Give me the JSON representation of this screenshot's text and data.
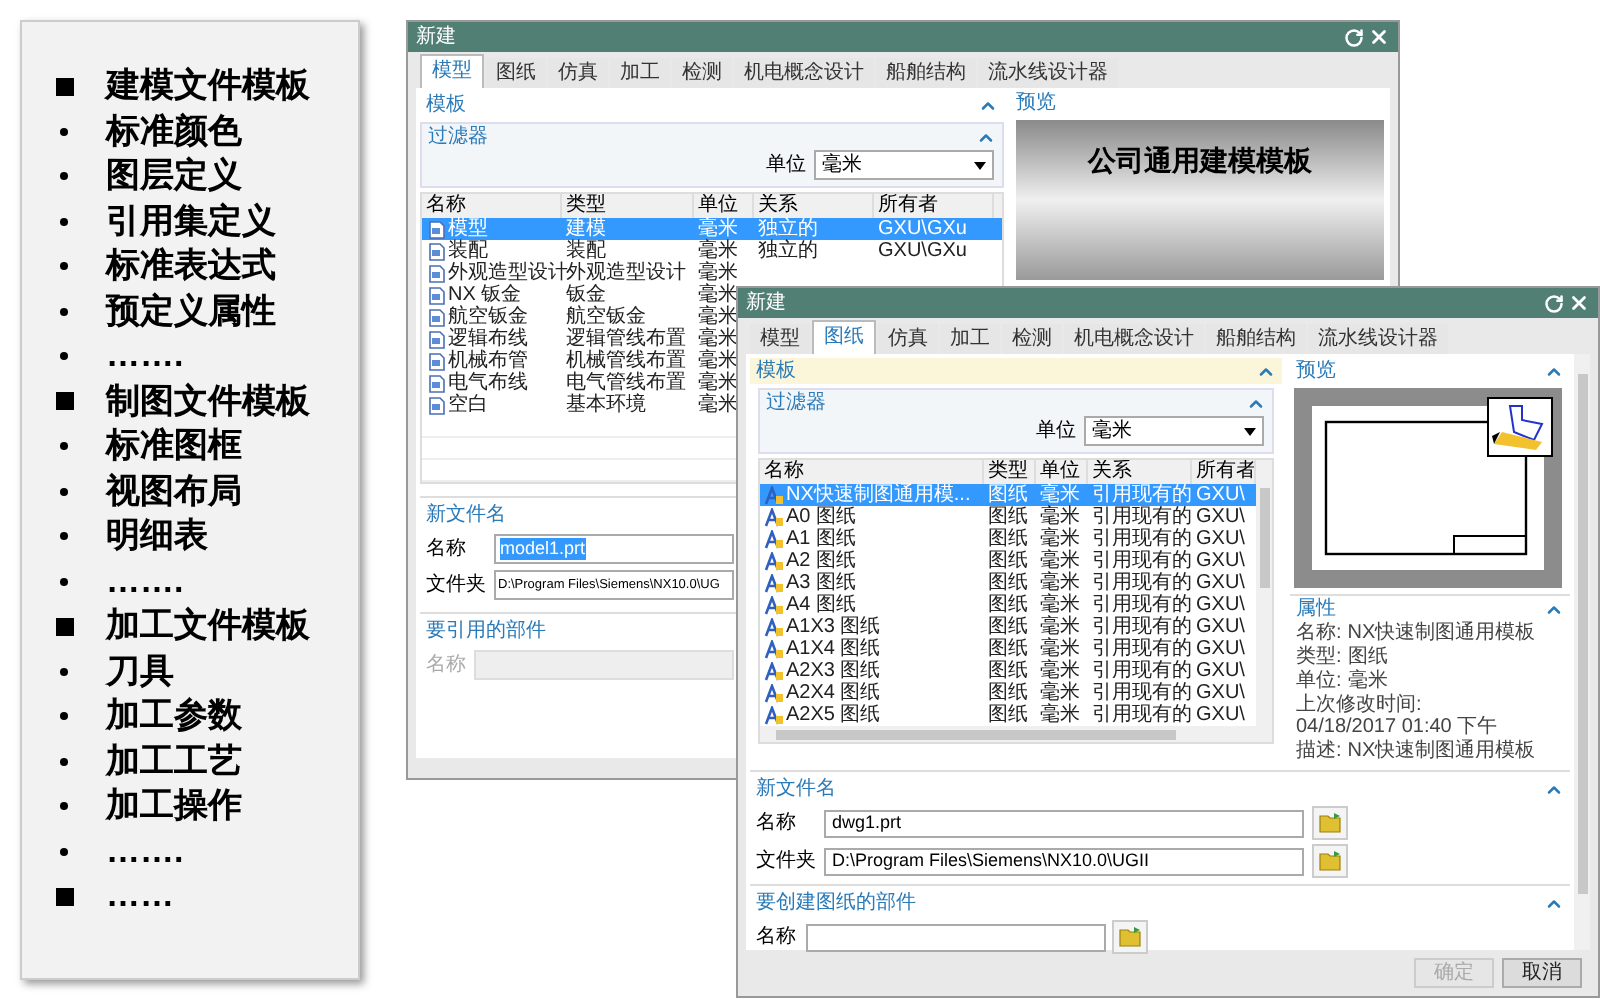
{
  "outline": [
    {
      "kind": "heading",
      "text": "建模文件模板"
    },
    {
      "kind": "item",
      "text": "标准颜色"
    },
    {
      "kind": "item",
      "text": "图层定义"
    },
    {
      "kind": "item",
      "text": "引用集定义"
    },
    {
      "kind": "item",
      "text": "标准表达式"
    },
    {
      "kind": "item",
      "text": "预定义属性"
    },
    {
      "kind": "item",
      "text": "……."
    },
    {
      "kind": "heading",
      "text": "制图文件模板"
    },
    {
      "kind": "item",
      "text": "标准图框"
    },
    {
      "kind": "item",
      "text": "视图布局"
    },
    {
      "kind": "item",
      "text": "明细表"
    },
    {
      "kind": "item",
      "text": "……."
    },
    {
      "kind": "heading",
      "text": "加工文件模板"
    },
    {
      "kind": "item",
      "text": "刀具"
    },
    {
      "kind": "item",
      "text": "加工参数"
    },
    {
      "kind": "item",
      "text": "加工工艺"
    },
    {
      "kind": "item",
      "text": "加工操作"
    },
    {
      "kind": "item",
      "text": "……."
    },
    {
      "kind": "heading",
      "text": "……"
    }
  ],
  "back_window": {
    "title": "新建",
    "tabs": [
      {
        "label": "模型",
        "selected": true
      },
      {
        "label": "图纸",
        "selected": false
      },
      {
        "label": "仿真",
        "selected": false
      },
      {
        "label": "加工",
        "selected": false
      },
      {
        "label": "检测",
        "selected": false
      },
      {
        "label": "机电概念设计",
        "selected": false
      },
      {
        "label": "船舶结构",
        "selected": false
      },
      {
        "label": "流水线设计器",
        "selected": false
      }
    ],
    "template": {
      "title": "模板",
      "expanded": true
    },
    "filter": {
      "title": "过滤器",
      "expanded": true,
      "unit_label": "单位",
      "unit_value": "毫米"
    },
    "columns": [
      "名称",
      "类型",
      "单位",
      "关系",
      "所有者"
    ],
    "rows": [
      {
        "name": "模型",
        "type": "建模",
        "unit": "毫米",
        "relation": "独立的",
        "owner": "GXU\\GXu",
        "selected": true
      },
      {
        "name": "装配",
        "type": "装配",
        "unit": "毫米",
        "relation": "独立的",
        "owner": "GXU\\GXu",
        "selected": false
      },
      {
        "name": "外观造型设计",
        "type": "外观造型设计",
        "unit": "毫米",
        "selected": false
      },
      {
        "name": "NX 钣金",
        "type": "钣金",
        "unit": "毫米",
        "selected": false
      },
      {
        "name": "航空钣金",
        "type": "航空钣金",
        "unit": "毫米",
        "selected": false
      },
      {
        "name": "逻辑布线",
        "type": "逻辑管线布置",
        "unit": "毫米",
        "selected": false
      },
      {
        "name": "机械布管",
        "type": "机械管线布置",
        "unit": "毫米",
        "selected": false
      },
      {
        "name": "电气布线",
        "type": "电气管线布置",
        "unit": "毫米",
        "selected": false
      },
      {
        "name": "空白",
        "type": "基本环境",
        "unit": "毫米",
        "selected": false
      }
    ],
    "new_file": {
      "title": "新文件名",
      "name_label": "名称",
      "name_value": "model1.prt",
      "name_highlighted": true,
      "folder_label": "文件夹",
      "folder_value": "D:\\Program Files\\Siemens\\NX10.0\\UG"
    },
    "ref_part": {
      "title": "要引用的部件",
      "name_label": "名称",
      "disabled": true
    },
    "preview": {
      "title": "预览",
      "text": "公司通用建模模板"
    }
  },
  "front_window": {
    "title": "新建",
    "tabs": [
      {
        "label": "模型",
        "selected": false
      },
      {
        "label": "图纸",
        "selected": true
      },
      {
        "label": "仿真",
        "selected": false
      },
      {
        "label": "加工",
        "selected": false
      },
      {
        "label": "检测",
        "selected": false
      },
      {
        "label": "机电概念设计",
        "selected": false
      },
      {
        "label": "船舶结构",
        "selected": false
      },
      {
        "label": "流水线设计器",
        "selected": false
      }
    ],
    "template": {
      "title": "模板",
      "expanded": true
    },
    "filter": {
      "title": "过滤器",
      "expanded": true,
      "unit_label": "单位",
      "unit_value": "毫米"
    },
    "columns": [
      "名称",
      "类型",
      "单位",
      "关系",
      "所有者"
    ],
    "rows": [
      {
        "name": "NX快速制图通用模...",
        "type": "图纸",
        "unit": "毫米",
        "relation": "引用现有的",
        "owner": "GXU\\",
        "selected": true
      },
      {
        "name": "A0 图纸",
        "type": "图纸",
        "unit": "毫米",
        "relation": "引用现有的",
        "owner": "GXU\\",
        "selected": false
      },
      {
        "name": "A1 图纸",
        "type": "图纸",
        "unit": "毫米",
        "relation": "引用现有的",
        "owner": "GXU\\",
        "selected": false
      },
      {
        "name": "A2 图纸",
        "type": "图纸",
        "unit": "毫米",
        "relation": "引用现有的",
        "owner": "GXU\\",
        "selected": false
      },
      {
        "name": "A3 图纸",
        "type": "图纸",
        "unit": "毫米",
        "relation": "引用现有的",
        "owner": "GXU\\",
        "selected": false
      },
      {
        "name": "A4 图纸",
        "type": "图纸",
        "unit": "毫米",
        "relation": "引用现有的",
        "owner": "GXU\\",
        "selected": false
      },
      {
        "name": "A1X3 图纸",
        "type": "图纸",
        "unit": "毫米",
        "relation": "引用现有的",
        "owner": "GXU\\",
        "selected": false
      },
      {
        "name": "A1X4 图纸",
        "type": "图纸",
        "unit": "毫米",
        "relation": "引用现有的",
        "owner": "GXU\\",
        "selected": false
      },
      {
        "name": "A2X3 图纸",
        "type": "图纸",
        "unit": "毫米",
        "relation": "引用现有的",
        "owner": "GXU\\",
        "selected": false
      },
      {
        "name": "A2X4 图纸",
        "type": "图纸",
        "unit": "毫米",
        "relation": "引用现有的",
        "owner": "GXU\\",
        "selected": false
      },
      {
        "name": "A2X5 图纸",
        "type": "图纸",
        "unit": "毫米",
        "relation": "引用现有的",
        "owner": "GXU\\",
        "selected": false
      }
    ],
    "preview": {
      "title": "预览",
      "expanded": true
    },
    "properties": {
      "title": "属性",
      "expanded": true,
      "items": [
        {
          "label": "名称:",
          "value": "NX快速制图通用模板"
        },
        {
          "label": "类型:",
          "value": "图纸"
        },
        {
          "label": "单位:",
          "value": "毫米"
        },
        {
          "label": "上次修改时间:",
          "value": "04/18/2017 01:40 下午"
        },
        {
          "label": "描述:",
          "value": "NX快速制图通用模板"
        }
      ]
    },
    "new_file": {
      "title": "新文件名",
      "expanded": true,
      "name_label": "名称",
      "name_value": "dwg1.prt",
      "folder_label": "文件夹",
      "folder_value": "D:\\Program Files\\Siemens\\NX10.0\\UGII"
    },
    "drawing_part": {
      "title": "要创建图纸的部件",
      "expanded": true,
      "name_label": "名称"
    },
    "buttons": [
      {
        "label": "确定",
        "disabled": true
      },
      {
        "label": "取消",
        "disabled": false
      }
    ]
  }
}
